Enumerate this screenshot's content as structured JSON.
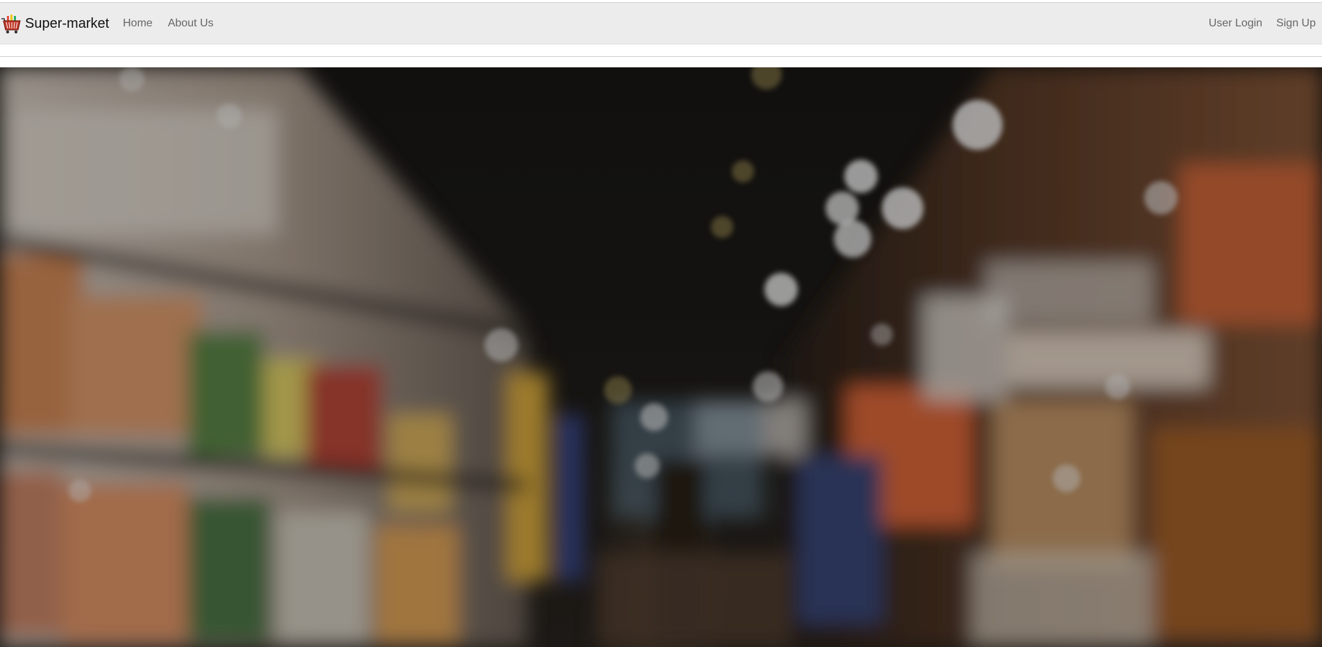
{
  "brand": {
    "name": "Super-market",
    "logo_icon": "shopping-basket-icon"
  },
  "nav": {
    "left": [
      {
        "label": "Home"
      },
      {
        "label": "About Us"
      }
    ],
    "right": [
      {
        "label": "User Login"
      },
      {
        "label": "Sign Up"
      }
    ]
  },
  "hero": {
    "image": "blurred-supermarket-aisle-photo"
  },
  "colors": {
    "navbar_bg": "#ececec",
    "nav_link": "#666666",
    "brand_text": "#111111",
    "basket_red": "#c0392b"
  }
}
